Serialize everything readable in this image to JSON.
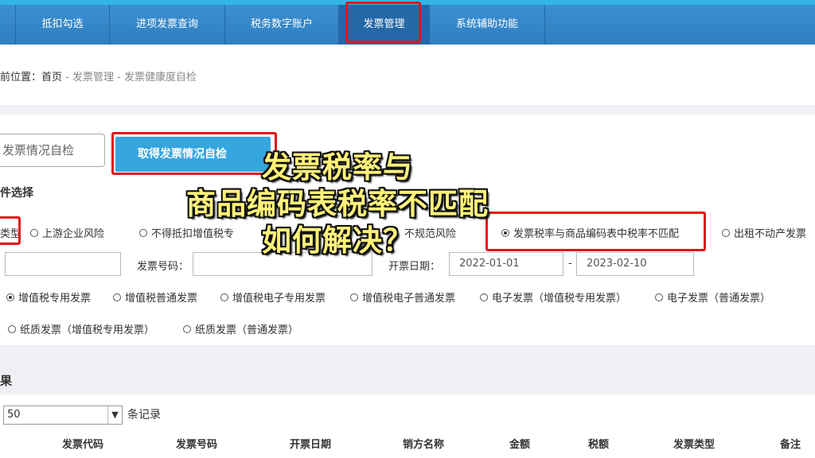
{
  "nav": {
    "items": [
      "抵扣勾选",
      "进项发票查询",
      "税务数字账户",
      "发票管理",
      "系统辅助功能"
    ],
    "active": "发票管理"
  },
  "breadcrumb": {
    "prefix": "前位置：",
    "home": "首页",
    "sep": " - ",
    "level2": "发票管理",
    "level3": "发票健康度自检"
  },
  "toolbar": {
    "tab_input_text": "发票情况自检",
    "primary_button": "取得发票情况自检"
  },
  "conditions": {
    "title": "件选择",
    "type_label": "类型",
    "risk_options": [
      {
        "label": "上游企业风险",
        "checked": false
      },
      {
        "label": "不得抵扣增值税专",
        "checked": false
      },
      {
        "label": "不规范风险",
        "checked": false
      },
      {
        "label": "发票税率与商品编码表中税率不匹配",
        "checked": true
      },
      {
        "label": "出租不动产发票",
        "checked": false
      }
    ],
    "invoice_no_label": "发票号码：",
    "date_label": "开票日期：",
    "date_from": "2022-01-01",
    "date_sep": "-",
    "date_to": "2023-02-10",
    "invoice_types": [
      {
        "label": "增值税专用发票",
        "checked": true
      },
      {
        "label": "增值税普通发票",
        "checked": false
      },
      {
        "label": "增值税电子专用发票",
        "checked": false
      },
      {
        "label": "增值税电子普通发票",
        "checked": false
      },
      {
        "label": "电子发票（增值税专用发票）",
        "checked": false
      },
      {
        "label": "电子发票（普通发票）",
        "checked": false
      },
      {
        "label": "纸质发票（增值税专用发票）",
        "checked": false
      },
      {
        "label": "纸质发票（普通发票）",
        "checked": false
      }
    ]
  },
  "results": {
    "title": "果",
    "page_size": "50",
    "page_size_suffix": "条记录",
    "columns": [
      "发票代码",
      "发票号码",
      "开票日期",
      "销方名称",
      "金额",
      "税额",
      "发票类型",
      "备注"
    ]
  },
  "overlay": {
    "line1": "发票税率与",
    "line2": "商品编码表税率不匹配",
    "line3": "如何解决？"
  },
  "colors": {
    "nav_bg": "#2f7fc1",
    "highlight": "#e1141b",
    "primary": "#36a6df",
    "caption": "#fff27a"
  }
}
